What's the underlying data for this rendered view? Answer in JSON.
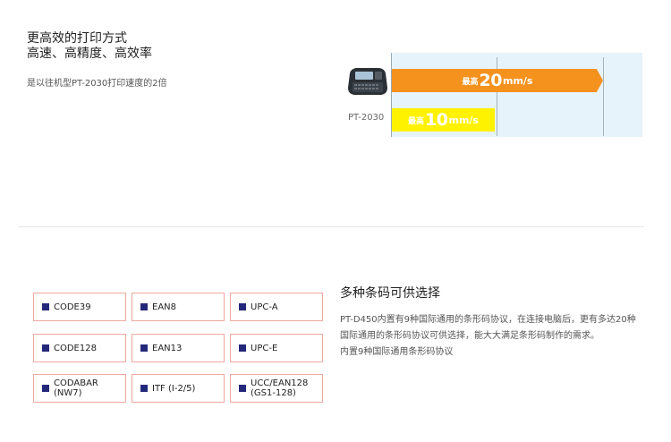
{
  "speed_section": {
    "heading_line1": "更高效的打印方式",
    "heading_line2": "高速、高精度、高效率",
    "note": "是以往机型PT-2030打印速度的2倍",
    "device_label": "PT-2030",
    "chart": {
      "fast_prefix": "最高",
      "fast_value": "20",
      "fast_unit": "mm/s",
      "slow_prefix": "最高",
      "slow_value": "10",
      "slow_unit": "mm/s"
    }
  },
  "chart_data": {
    "type": "bar",
    "orientation": "horizontal",
    "categories": [
      "",
      "PT-2030"
    ],
    "values": [
      20,
      10
    ],
    "unit": "mm/s",
    "xlim": [
      0,
      24
    ],
    "gridlines": [
      10,
      20
    ],
    "colors": [
      "#f5921e",
      "#fff200"
    ]
  },
  "barcode_section": {
    "heading": "多种条码可供选择",
    "desc_line1": "PT-D450内置有9种国际通用的条形码协议，在连接电脑后，更有多达20种",
    "desc_line2": "国际通用的条形码协议可供选择，能大大满足条形码制作的需求。",
    "desc_line3": "内置9种国际通用条形码协议",
    "codes": [
      {
        "l1": "CODE39",
        "l2": ""
      },
      {
        "l1": "EAN8",
        "l2": ""
      },
      {
        "l1": "UPC-A",
        "l2": ""
      },
      {
        "l1": "CODE128",
        "l2": ""
      },
      {
        "l1": "EAN13",
        "l2": ""
      },
      {
        "l1": "UPC-E",
        "l2": ""
      },
      {
        "l1": "CODABAR (NW7)",
        "l2": ""
      },
      {
        "l1": "ITF (I-2/5)",
        "l2": ""
      },
      {
        "l1": "UCC/EAN128",
        "l2": "(GS1-128)"
      }
    ],
    "square_color": "#24287a",
    "border_color": "#f0a8a0"
  }
}
